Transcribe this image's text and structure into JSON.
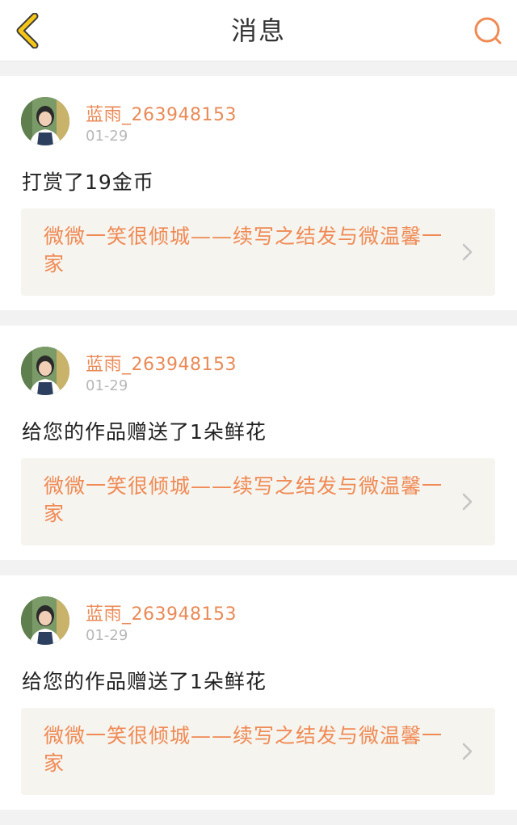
{
  "header": {
    "title": "消息",
    "back_icon": "chevron-left-icon",
    "search_icon": "search-icon",
    "accent_color": "#f5c518",
    "search_color": "#f08a55"
  },
  "messages": [
    {
      "username": "蓝雨_263948153",
      "date": "01-29",
      "text": "打赏了19金币",
      "work_title": "微微一笑很倾城——续写之结发与微温馨一家"
    },
    {
      "username": "蓝雨_263948153",
      "date": "01-29",
      "text": "给您的作品赠送了1朵鲜花",
      "work_title": "微微一笑很倾城——续写之结发与微温馨一家"
    },
    {
      "username": "蓝雨_263948153",
      "date": "01-29",
      "text": "给您的作品赠送了1朵鲜花",
      "work_title": "微微一笑很倾城——续写之结发与微温馨一家"
    }
  ]
}
